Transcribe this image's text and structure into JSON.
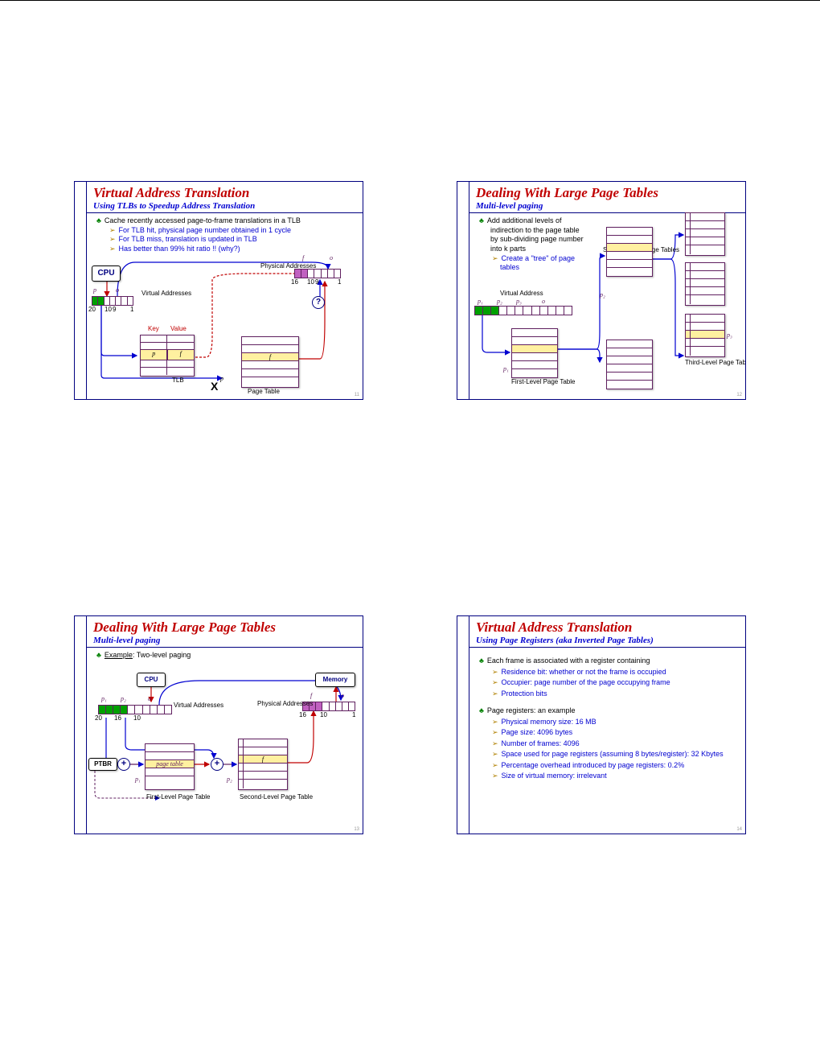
{
  "slides": {
    "s1": {
      "title": "Virtual  Address  Translation",
      "subtitle": "Using TLBs to Speedup Address Translation",
      "bullet": "Cache recently accessed page-to-frame translations in a TLB",
      "sub1": "For TLB hit, physical page number obtained in 1 cycle",
      "sub2": "For TLB miss, translation is updated in TLB",
      "sub3": "Has better than 99% hit ratio !! (why?)",
      "cpu": "CPU",
      "va_label": "Virtual Addresses",
      "pa_label": "Physical Addresses",
      "key": "Key",
      "value": "Value",
      "tlb": "TLB",
      "pagetable": "Page Table",
      "p": "p",
      "o": "o",
      "f": "f",
      "n20": "20",
      "n10": "10",
      "n9": "9",
      "n1": "1",
      "n16": "16",
      "x": "X",
      "q": "?",
      "pagenum": "11"
    },
    "s2": {
      "title": "Dealing  With  Large  Page  Tables",
      "subtitle": "Multi-level  paging",
      "bullet_l1": "Add additional levels of",
      "bullet_l2": "indirection to the page table",
      "bullet_l3": "by sub-dividing page number",
      "bullet_l4": "into k parts",
      "sub1a": "Create a \"tree\" of page",
      "sub1b": "tables",
      "va": "Virtual Address",
      "p1": "p₁",
      "p2": "p₂",
      "p3": "p₃",
      "o": "o",
      "first": "First-Level Page Table",
      "second": "Second-Level Page Tables",
      "third": "Third-Level Page Tables",
      "pagenum": "12"
    },
    "s3": {
      "title": "Dealing  With  Large  Page  Tables",
      "subtitle": "Multi-level  paging",
      "example": "Example",
      "example_rest": ": Two-level paging",
      "cpu": "CPU",
      "memory": "Memory",
      "va_label": "Virtual Addresses",
      "pa_label": "Physical Addresses",
      "ptbr": "PTBR",
      "pt_text": "page table",
      "first": "First-Level Page Table",
      "second": "Second-Level Page Table",
      "p1": "p₁",
      "p2": "p₂",
      "o": "o",
      "f": "f",
      "n20": "20",
      "n16": "16",
      "n10": "10",
      "n1": "1",
      "plus": "+",
      "pagenum": "13"
    },
    "s4": {
      "title": "Virtual  Address  Translation",
      "subtitle": "Using Page Registers (aka Inverted Page Tables)",
      "b1": "Each frame is associated with a register containing",
      "b1s1": "Residence bit: whether or not the frame is occupied",
      "b1s2": "Occupier: page number of the page occupying frame",
      "b1s3": "Protection bits",
      "b2": "Page registers: an example",
      "b2s1": "Physical memory size: 16 MB",
      "b2s2": "Page size: 4096 bytes",
      "b2s3": "Number of frames: 4096",
      "b2s4": "Space used for page registers (assuming 8 bytes/register): 32 Kbytes",
      "b2s5": "Percentage overhead introduced by page registers: 0.2%",
      "b2s6": "Size of virtual memory: irrelevant",
      "pagenum": "14"
    }
  }
}
